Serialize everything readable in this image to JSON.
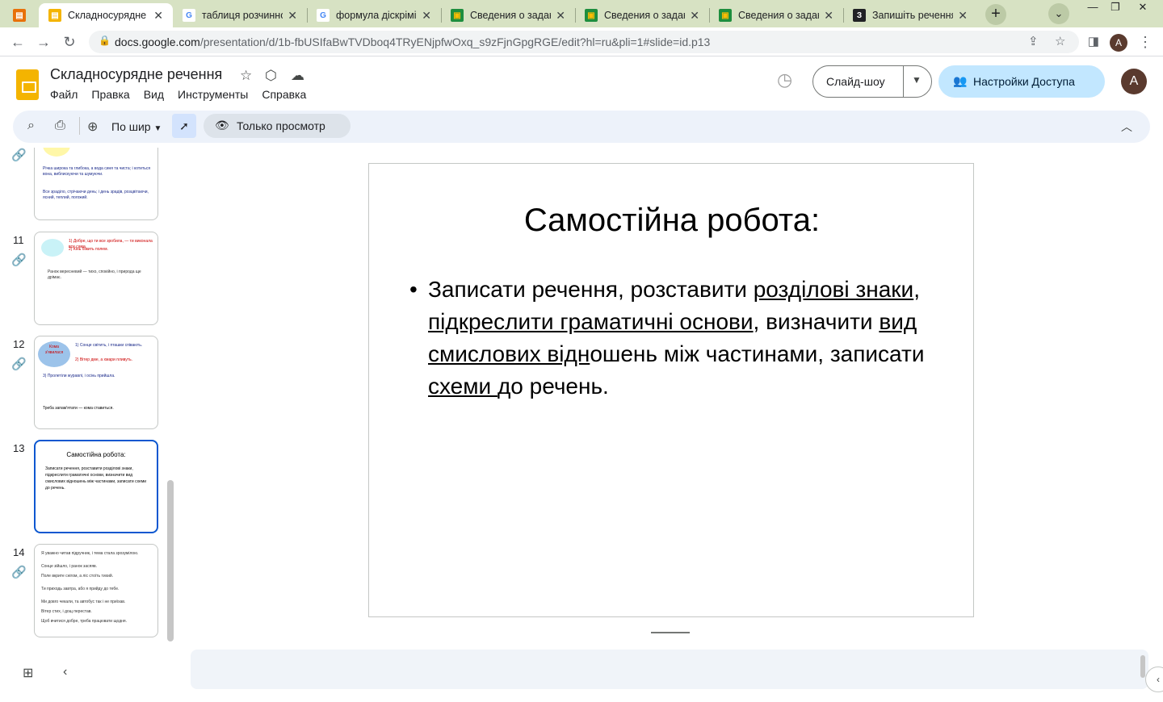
{
  "browser": {
    "tabs": [
      {
        "title": "Складносурядне р",
        "favicon": "slides-icon",
        "active": true
      },
      {
        "title": "таблиця розчинно",
        "favicon": "google-icon",
        "active": false
      },
      {
        "title": "формула діскріміна",
        "favicon": "google-icon",
        "active": false
      },
      {
        "title": "Сведения о задани",
        "favicon": "classroom-icon",
        "active": false
      },
      {
        "title": "Сведения о задани",
        "favicon": "classroom-icon",
        "active": false
      },
      {
        "title": "Сведения о задани",
        "favicon": "classroom-icon",
        "active": false
      },
      {
        "title": "Запишіть речення",
        "favicon": "assignment-icon",
        "active": false
      }
    ],
    "url_main": "docs.google.com",
    "url_rest": "/presentation/d/1b-fbUSIfaBwTVDboq4TRyENjpfwOxq_s9zFjnGpgRGE/edit?hl=ru&pli=1#slide=id.p13",
    "profile_initial": "A"
  },
  "header": {
    "doc_title": "Складносурядне речення",
    "menu": [
      "Файл",
      "Правка",
      "Вид",
      "Инструменты",
      "Справка"
    ],
    "slideshow_label": "Слайд-шоу",
    "share_label": "Настройки Доступа",
    "avatar_initial": "A"
  },
  "toolbar": {
    "zoom_label": "По шир",
    "view_only_label": "Только просмотр"
  },
  "filmstrip": {
    "slides": [
      {
        "number": "11",
        "lines": [
          "1) Добре, що ти все зробила, — ти виконала все сама.",
          "2) Кінь біжить полем.",
          "Ранок вересневий — тихо, спокійно, і природа ще дрімає."
        ]
      },
      {
        "number": "12",
        "lines": [
          "Кома з'явилася",
          "1) Сонце світить, і пташки співають.",
          "2) Вітер дме, а хмари пливуть.",
          "3) Пролетіли журавлі, і осінь прийшла.",
          "Треба запам'ятати — кома ставиться."
        ]
      },
      {
        "number": "13",
        "title": "Самостійна робота:",
        "body": "Записати речення, розставити розділові знаки, підкреслити граматичні основи, визначити вид смислових відношень між частинами, записати схеми до речень."
      },
      {
        "number": "14",
        "lines": [
          "Я уважно читав підручник, і тема стала зрозумілою.",
          "Сонце зійшло, і ранок засяяв.",
          "Поле вкрите снігом, а ліс стоїть тихий.",
          "Ти приходь завтра, або я прийду до тебе.",
          "Ми довго чекали, та автобус так і не приїхав.",
          "Вітер стих, і дощ перестав.",
          "Щоб вчитися добре, треба працювати щодня."
        ]
      }
    ],
    "prev_lines": [
      "Річка широка та глибока, а вода синя та чиста; і котиться вона, виблискуючи та шумуючи.",
      "Все зраділо, стрічаючи день; і день зрадів, розцвітаючи, ясний, теплий, погожий."
    ]
  },
  "slide": {
    "title": "Самостійна робота:",
    "body_parts": [
      {
        "text": "Записати речення, розставити ",
        "u": false
      },
      {
        "text": "розділові знаки",
        "u": true
      },
      {
        "text": ", ",
        "u": false
      },
      {
        "text": "підкреслити граматичні основи",
        "u": true
      },
      {
        "text": ", визначити ",
        "u": false
      },
      {
        "text": "вид смислових відн",
        "u": true
      },
      {
        "text": "ошень між частинами, записати ",
        "u": false
      },
      {
        "text": "схеми ",
        "u": true
      },
      {
        "text": "до речень.",
        "u": false
      }
    ]
  },
  "colors": {
    "accent": "#0b57d0",
    "share_bg": "#c2e7ff",
    "tabstrip": "#d7e2c3",
    "toolbar": "#edf2fa"
  }
}
